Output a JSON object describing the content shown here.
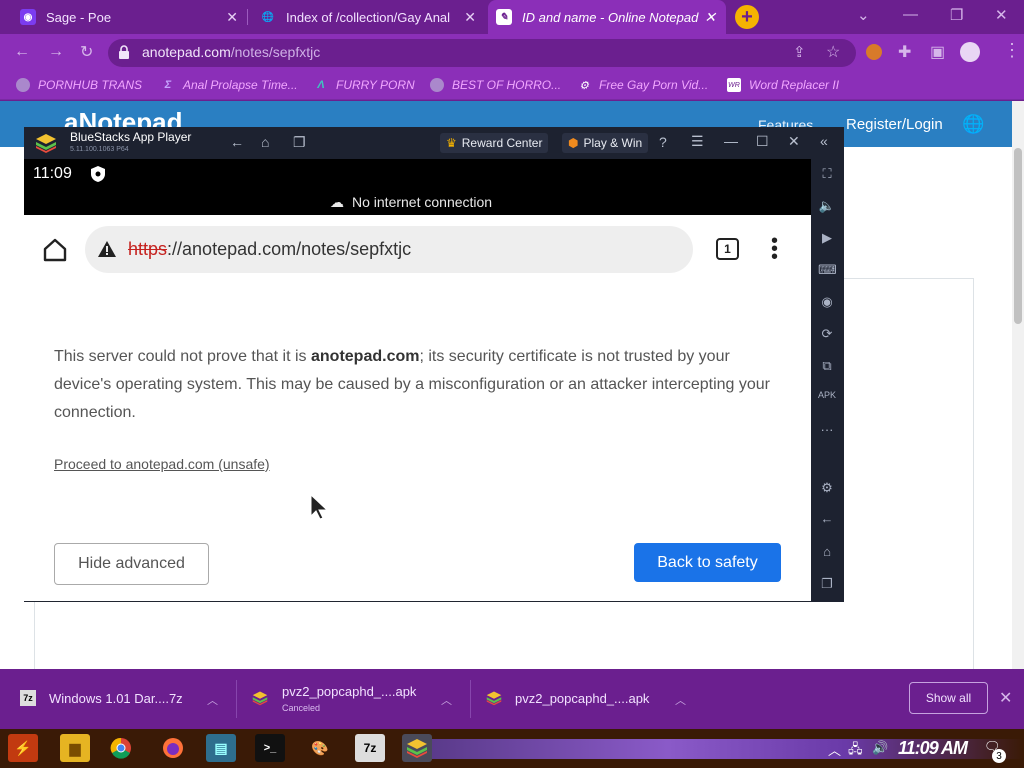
{
  "browser": {
    "tabs": [
      {
        "title": "Sage - Poe",
        "active": false
      },
      {
        "title": "Index of /collection/Gay Anal",
        "active": false
      },
      {
        "title": "ID and name - Online Notepad",
        "active": true
      }
    ],
    "address": {
      "domain": "anotepad.com",
      "path": "/notes/sepfxtjc"
    },
    "bookmarks": [
      "PORNHUB TRANS",
      "Anal Prolapse Time...",
      "FURRY PORN",
      "BEST OF HORRO...",
      "Free Gay Porn Vid...",
      "Word Replacer II"
    ]
  },
  "site": {
    "brand": "aNotepad",
    "nav": {
      "features": "Features",
      "register": "Register/Login"
    }
  },
  "bluestacks": {
    "app_name": "BlueStacks App Player",
    "version": "5.11.100.1063 P64",
    "reward_center": "Reward Center",
    "play_win": "Play & Win"
  },
  "android": {
    "time": "11:09",
    "no_internet": "No internet connection",
    "url": {
      "scheme": "https",
      "rest": "://anotepad.com/notes/sepfxtjc"
    },
    "tab_count": "1",
    "warning": {
      "part1": "This server could not prove that it is ",
      "domain": "anotepad.com",
      "part2": "; its security certificate is not trusted by your device's operating system. This may be caused by a misconfiguration or an attacker intercepting your connection."
    },
    "proceed_link": "Proceed to anotepad.com (unsafe)",
    "hide_advanced": "Hide advanced",
    "back_to_safety": "Back to safety",
    "colors": {
      "primary_button": "#1a73e8",
      "https_strike": "#c5221f"
    }
  },
  "downloads": {
    "items": [
      {
        "name": "Windows 1.01 Dar....7z",
        "status": ""
      },
      {
        "name": "pvz2_popcaphd_....apk",
        "status": "Canceled"
      },
      {
        "name": "pvz2_popcaphd_....apk",
        "status": ""
      }
    ],
    "show_all": "Show all"
  },
  "taskbar": {
    "time": "11:09 AM",
    "notifications": "3"
  }
}
